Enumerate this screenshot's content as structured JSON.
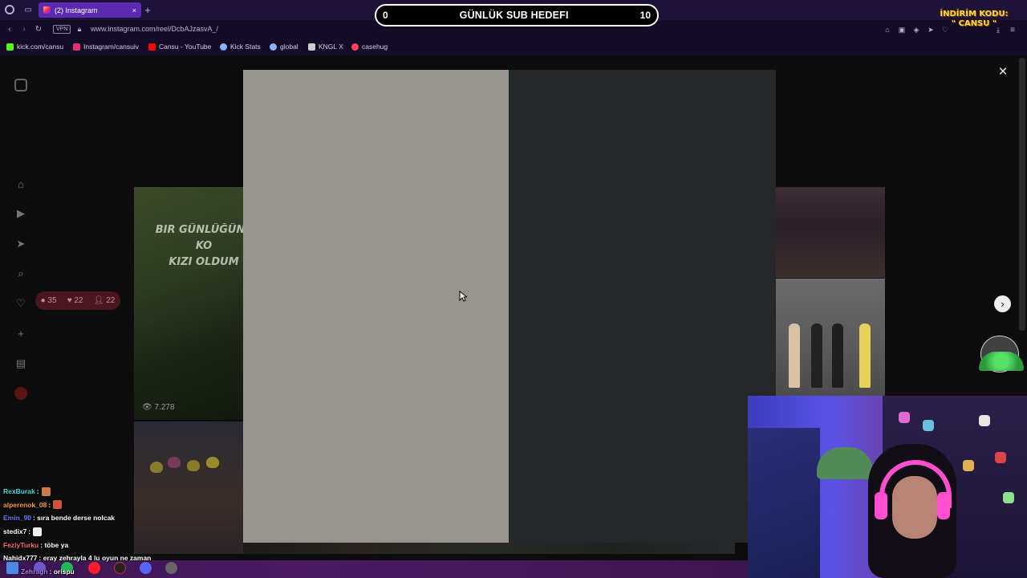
{
  "browser": {
    "tab_title": "(2) Instagram",
    "new_tab": "+",
    "vpn_badge": "VPN",
    "url": "www.instagram.com/reel/DcbAJzasvA_/"
  },
  "bookmarks": [
    {
      "label": "kick.com/cansu",
      "color": "#53fc18"
    },
    {
      "label": "Instagram/cansuiv",
      "color": "#e1306c"
    },
    {
      "label": "Cansu - YouTube",
      "color": "#ff0000"
    },
    {
      "label": "Kick Stats",
      "color": "#8ab4f8"
    },
    {
      "label": "global",
      "color": "#8ab4f8"
    },
    {
      "label": "KNGL X",
      "color": "#cccccc"
    },
    {
      "label": "casehug",
      "color": "#ff4060"
    }
  ],
  "goal": {
    "current": "0",
    "title": "GÜNLÜK SUB HEDEFI",
    "target": "10"
  },
  "promo": {
    "line1": "İNDİRİM KODU:",
    "line2": "\" CANSU \""
  },
  "stats": {
    "comments": "35",
    "likes": "22",
    "viewers": "22"
  },
  "reels": {
    "caption_1": "BIR GÜNLÜĞÜNE KO",
    "caption_2": "KIZI OLDUM",
    "views": "7.278"
  },
  "modal": {
    "close": "×",
    "next": "›"
  },
  "chat": [
    {
      "user": "RexBurak",
      "text": "",
      "user_color": "#3ee0e0",
      "emote": "#c97a4a"
    },
    {
      "user": "alperenok_08",
      "text": "",
      "user_color": "#ff9b3a",
      "emote": "#d0533a"
    },
    {
      "user": "Emin_90",
      "text": "sıra bende derse nolcak",
      "user_color": "#6a7cff",
      "emote": ""
    },
    {
      "user": "stedix7",
      "text": "",
      "user_color": "#ffffff",
      "emote": "#eeeeee"
    },
    {
      "user": "FeziyTurku",
      "text": "töbe ya",
      "user_color": "#ff6a6a",
      "emote": ""
    },
    {
      "user": "Nahidx777",
      "text": "eray zehrayla 4 lu oyun ne zaman",
      "user_color": "#ffffff",
      "emote": ""
    },
    {
      "user": "Zehragn",
      "text": "orispu",
      "user_color": "#b57bff",
      "emote": ""
    }
  ]
}
